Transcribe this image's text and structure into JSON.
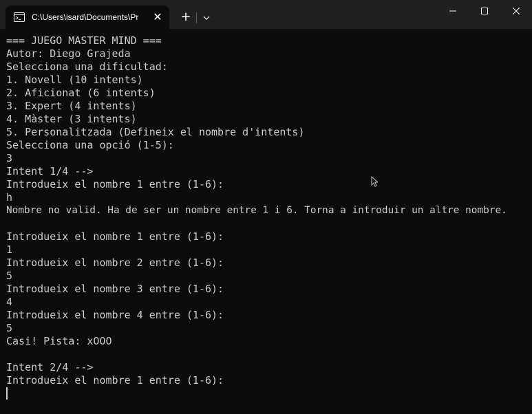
{
  "tab": {
    "title": "C:\\Users\\isard\\Documents\\Pr",
    "close_glyph": "✕",
    "icon": "terminal-icon"
  },
  "titlebar": {
    "new_tab_glyph": "+",
    "dropdown_icon": "chevron-down-icon",
    "minimize_icon": "minimize-icon",
    "maximize_icon": "maximize-icon",
    "close_icon": "close-icon"
  },
  "terminal": {
    "lines": [
      "=== JUEGO MASTER MIND ===",
      "Autor: Diego Grajeda",
      "Selecciona una dificultad:",
      "1. Novell (10 intents)",
      "2. Aficionat (6 intents)",
      "3. Expert (4 intents)",
      "4. Màster (3 intents)",
      "5. Personalitzada (Defineix el nombre d'intents)",
      "Selecciona una opció (1-5):",
      "3",
      "Intent 1/4 -->",
      "Introdueix el nombre 1 entre (1-6):",
      "h",
      "Nombre no valid. Ha de ser un nombre entre 1 i 6. Torna a introduir un altre nombre.",
      "",
      "Introdueix el nombre 1 entre (1-6):",
      "1",
      "Introdueix el nombre 2 entre (1-6):",
      "5",
      "Introdueix el nombre 3 entre (1-6):",
      "4",
      "Introdueix el nombre 4 entre (1-6):",
      "5",
      "Casi! Pista: xOOO",
      "",
      "Intent 2/4 -->",
      "Introdueix el nombre 1 entre (1-6):"
    ]
  },
  "colors": {
    "terminal_bg": "#0c0c0c",
    "titlebar_bg": "#202020",
    "text": "#cccccc"
  }
}
